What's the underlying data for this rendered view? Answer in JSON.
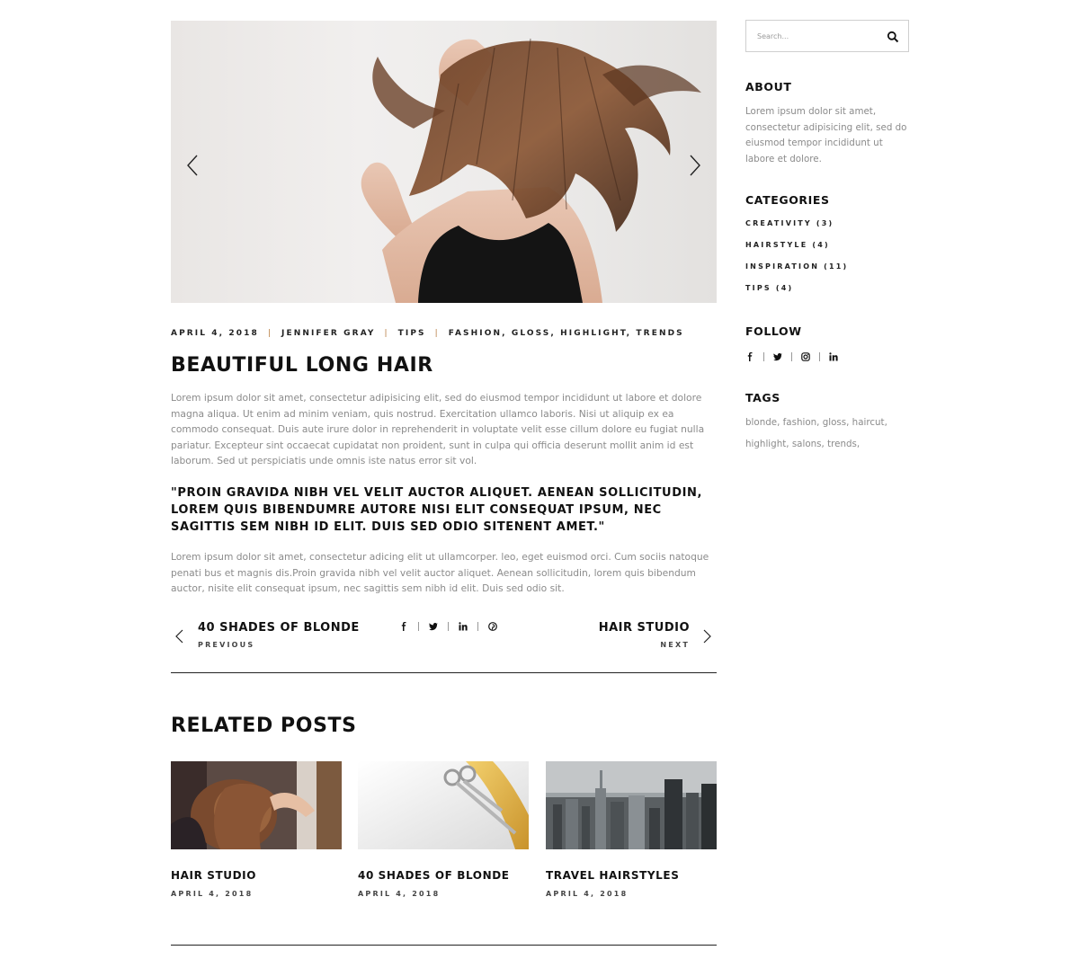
{
  "hero": {
    "image": "woman-tossing-long-brown-hair",
    "prev_icon": "chevron-left-icon",
    "next_icon": "chevron-right-icon"
  },
  "post": {
    "date": "APRIL 4, 2018",
    "author": "JENNIFER GRAY",
    "category": "TIPS",
    "tags": "FASHION, GLOSS, HIGHLIGHT, TRENDS",
    "title": "BEAUTIFUL LONG HAIR",
    "paragraph_1": "Lorem ipsum dolor sit amet, consectetur adipisicing elit, sed do eiusmod tempor incididunt ut labore et dolore magna aliqua. Ut enim ad minim veniam, quis nostrud. Exercitation ullamco laboris. Nisi ut aliquip ex ea commodo consequat. Duis aute irure dolor in reprehenderit in voluptate velit esse cillum dolore eu fugiat nulla pariatur. Excepteur sint occaecat cupidatat non proident, sunt in culpa qui officia deserunt mollit anim id est laborum. Sed ut perspiciatis unde omnis iste natus error sit vol.",
    "quote": "\"PROIN GRAVIDA NIBH VEL VELIT AUCTOR ALIQUET. AENEAN SOLLICITUDIN, LOREM QUIS BIBENDUMRE AUTORE NISI ELIT CONSEQUAT IPSUM, NEC SAGITTIS SEM NIBH ID ELIT. DUIS SED ODIO SITENENT AMET.\"",
    "paragraph_2": "Lorem ipsum dolor sit amet, consectetur adicing elit ut ullamcorper. leo, eget euismod orci. Cum sociis natoque penati bus et magnis dis.Proin gravida nibh vel velit auctor aliquet. Aenean sollicitudin, lorem quis bibendum auctor, nisite elit consequat ipsum, nec sagittis sem nibh id elit. Duis sed odio sit."
  },
  "post_nav": {
    "prev_title": "40 SHADES OF BLONDE",
    "prev_label": "PREVIOUS",
    "next_title": "HAIR STUDIO",
    "next_label": "NEXT",
    "share_icons": [
      "facebook-icon",
      "twitter-icon",
      "linkedin-icon",
      "pinterest-icon"
    ]
  },
  "related": {
    "heading": "RELATED POSTS",
    "items": [
      {
        "title": "HAIR STUDIO",
        "date": "APRIL 4, 2018",
        "image": "stylist-curling-hair"
      },
      {
        "title": "40 SHADES OF BLONDE",
        "date": "APRIL 4, 2018",
        "image": "scissors-cutting-blonde-hair"
      },
      {
        "title": "TRAVEL HAIRSTYLES",
        "date": "APRIL 4, 2018",
        "image": "city-skyline"
      }
    ]
  },
  "sidebar": {
    "search_placeholder": "Search...",
    "about_heading": "ABOUT",
    "about_text": "Lorem ipsum dolor sit amet, consectetur adipisicing elit, sed do eiusmod tempor incididunt ut labore et dolore.",
    "categories_heading": "CATEGORIES",
    "categories": [
      {
        "label": "CREATIVITY (3)"
      },
      {
        "label": "HAIRSTYLE (4)"
      },
      {
        "label": "INSPIRATION (11)"
      },
      {
        "label": "TIPS (4)"
      }
    ],
    "follow_heading": "FOLLOW",
    "follow_icons": [
      "facebook-icon",
      "twitter-icon",
      "instagram-icon",
      "linkedin-icon"
    ],
    "tags_heading": "TAGS",
    "tags_line_1": "blonde, fashion, gloss, haircut,",
    "tags_line_2": "highlight, salons, trends,"
  },
  "colors": {
    "accent": "#b67a3c",
    "text": "#111111",
    "muted": "#8b8b8b"
  }
}
